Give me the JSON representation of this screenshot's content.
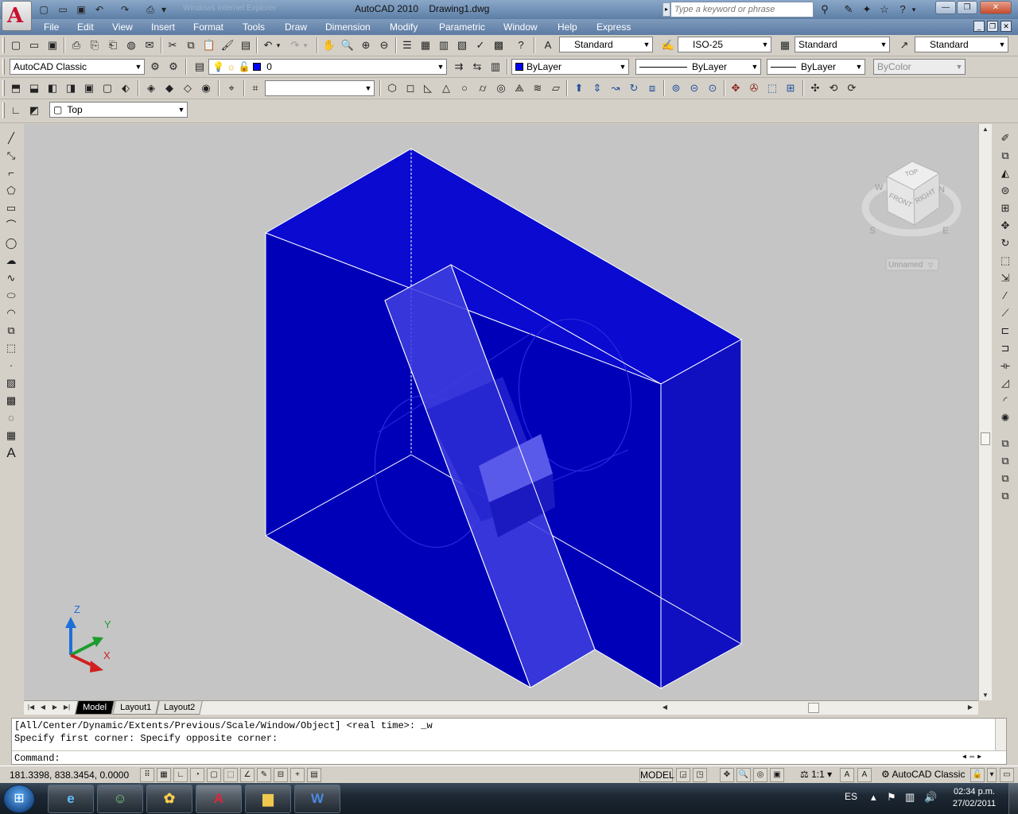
{
  "window": {
    "title": "AutoCAD 2010    Drawing1.dwg",
    "ghost_title": "Windows Internet Explorer",
    "search_placeholder": "Type a keyword or phrase"
  },
  "menu": [
    "File",
    "Edit",
    "View",
    "Insert",
    "Format",
    "Tools",
    "Draw",
    "Dimension",
    "Modify",
    "Parametric",
    "Window",
    "Help",
    "Express"
  ],
  "styles_toolbar": {
    "text_style": "Standard",
    "dim_style": "ISO-25",
    "table_style": "Standard",
    "multileader_style": "Standard"
  },
  "workspace_combo": "AutoCAD Classic",
  "layer_combo": "0",
  "properties": {
    "color": "ByLayer",
    "linetype": "ByLayer",
    "lineweight": "ByLayer",
    "plotstyle": "ByColor",
    "color_hex": "#0000ff"
  },
  "view_combo": "Top",
  "viewport": {
    "background": "#c5c5c5",
    "solid_color": "#0000c8",
    "viewcube": {
      "top": "TOP",
      "front": "FRONT",
      "right": "RIGHT",
      "compass_n": "N",
      "compass_s": "S",
      "compass_e": "E",
      "compass_w": "W",
      "ucs_menu": "Unnamed"
    },
    "ucs_axes": {
      "x": "X",
      "y": "Y",
      "z": "Z"
    }
  },
  "tabs": [
    "Model",
    "Layout1",
    "Layout2"
  ],
  "active_tab": "Model",
  "command": {
    "history": [
      "[All/Center/Dynamic/Extents/Previous/Scale/Window/Object] <real time>: _w",
      "Specify first corner: Specify opposite corner:"
    ],
    "prompt": "Command:"
  },
  "status": {
    "coords": "181.3398, 838.3454, 0.0000",
    "space": "MODEL",
    "annotation_scale": "1:1",
    "workspace": "AutoCAD Classic"
  },
  "taskbar": {
    "language": "ES",
    "time": "02:34 p.m.",
    "date": "27/02/2011"
  }
}
